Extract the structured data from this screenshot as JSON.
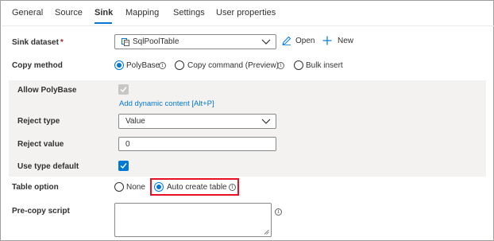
{
  "tabs": [
    {
      "label": "General",
      "active": false
    },
    {
      "label": "Source",
      "active": false
    },
    {
      "label": "Sink",
      "active": true
    },
    {
      "label": "Mapping",
      "active": false
    },
    {
      "label": "Settings",
      "active": false
    },
    {
      "label": "User properties",
      "active": false
    }
  ],
  "sink_dataset": {
    "label": "Sink dataset",
    "required_mark": "*",
    "value": "SqlPoolTable",
    "open_label": "Open",
    "new_label": "New"
  },
  "copy_method": {
    "label": "Copy method",
    "options": [
      {
        "label": "PolyBase",
        "selected": true
      },
      {
        "label": "Copy command (Preview)",
        "selected": false
      },
      {
        "label": "Bulk insert",
        "selected": false
      }
    ]
  },
  "allow_polybase": {
    "label": "Allow PolyBase",
    "checked": true,
    "disabled": true,
    "dynamic_link": "Add dynamic content [Alt+P]"
  },
  "reject_type": {
    "label": "Reject type",
    "value": "Value"
  },
  "reject_value": {
    "label": "Reject value",
    "value": "0"
  },
  "use_type_default": {
    "label": "Use type default",
    "checked": true
  },
  "table_option": {
    "label": "Table option",
    "options": [
      {
        "label": "None",
        "selected": false
      },
      {
        "label": "Auto create table",
        "selected": true
      }
    ]
  },
  "pre_copy_script": {
    "label": "Pre-copy script",
    "value": ""
  },
  "info_glyph": "i",
  "colors": {
    "accent": "#0078d4",
    "highlight": "#e81123",
    "required": "#a4262c"
  }
}
